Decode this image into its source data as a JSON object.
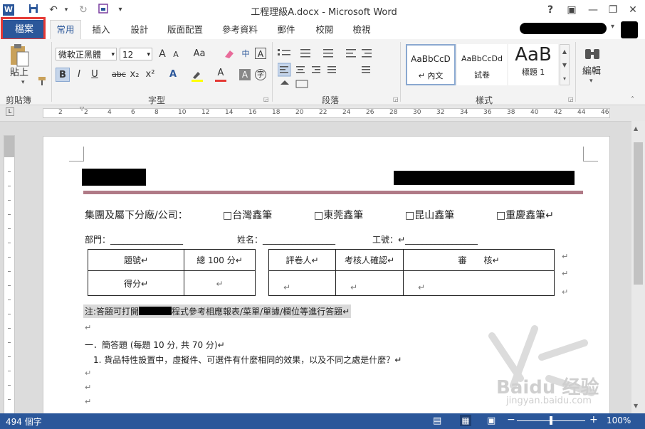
{
  "window": {
    "title": "工程理級A.docx - Microsoft Word",
    "help": "?",
    "ribbon_display": "▣",
    "minimize": "—",
    "restore": "❐",
    "close": "✕"
  },
  "quick_access": {
    "app_icon": "W",
    "save_icon": "save-icon",
    "undo": "↶",
    "redo": "↻",
    "custom": "▾"
  },
  "tabs": [
    "檔案",
    "常用",
    "插入",
    "設計",
    "版面配置",
    "參考資料",
    "郵件",
    "校閱",
    "檢視"
  ],
  "ribbon": {
    "clipboard": {
      "paste": "貼上",
      "group": "剪貼簿"
    },
    "font": {
      "family": "微軟正黑體",
      "size": "12",
      "grow": "A",
      "shrink": "A",
      "case": "Aa",
      "bold": "B",
      "italic": "I",
      "underline": "U",
      "strike": "abc",
      "sub": "x₂",
      "sup": "x²",
      "group": "字型"
    },
    "paragraph": {
      "group": "段落"
    },
    "styles": {
      "items": [
        {
          "preview": "AaBbCcD",
          "name": "↵ 內文"
        },
        {
          "preview": "AaBbCcDd",
          "name": "試卷"
        },
        {
          "preview": "AaB",
          "name": "標題 1"
        }
      ],
      "group": "樣式"
    },
    "editing": {
      "label": "編輯"
    }
  },
  "ruler": {
    "numbers": [
      "2",
      "2",
      "4",
      "6",
      "8",
      "10",
      "12",
      "14",
      "16",
      "18",
      "20",
      "22",
      "24",
      "26",
      "28",
      "30",
      "32",
      "34",
      "36",
      "38",
      "40",
      "42",
      "44",
      "46"
    ]
  },
  "document": {
    "company_line": "集團及屬下分廠/公司：",
    "options": [
      "□台灣鑫筆",
      "□東莞鑫筆",
      "□昆山鑫筆",
      "□重慶鑫筆↵"
    ],
    "dept": "部門：_________________",
    "name": "姓名：_________________",
    "empid": "工號：↵_________________",
    "score_table": {
      "h1": "題號↵",
      "h2": "總 100 分↵",
      "r1": "得分↵",
      "r2": "↵"
    },
    "review_table": {
      "h1": "評卷人↵",
      "h2": "考核人確認↵",
      "h3": "審　　核↵",
      "v1": "↵",
      "v2": "↵",
      "v3": "↵"
    },
    "note_prefix": "注:答題可打開",
    "note_suffix": "程式參考相應報表/菜單/單據/欄位等進行答題↵",
    "blank": "↵",
    "section1": "一．簡答題 (每題 10 分, 共 70 分)↵",
    "question1": "1. 貨品特性設置中，虛擬件、可選件有什麼相同的效果，以及不同之處是什麼？↵"
  },
  "watermark": {
    "brand": "Baidu 经验",
    "url": "jingyan.baidu.com"
  },
  "status": {
    "words": "494 個字",
    "zoom": "100%"
  },
  "colors": {
    "accent": "#2b579a",
    "highlight_box": "#e53935"
  }
}
